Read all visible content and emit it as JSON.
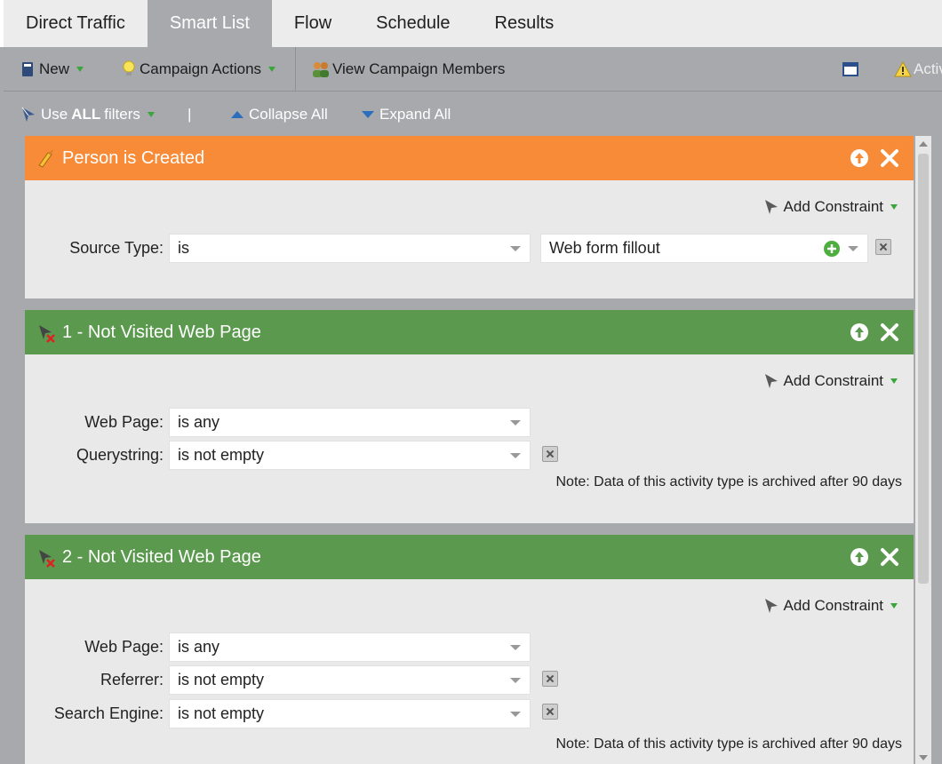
{
  "tabs": [
    "Direct Traffic",
    "Smart List",
    "Flow",
    "Schedule",
    "Results"
  ],
  "toolbar": {
    "new_label": "New",
    "campaign_actions_label": "Campaign Actions",
    "view_members_label": "View Campaign Members",
    "activate_label": "Activ"
  },
  "filterbar": {
    "use_label": "Use",
    "all_label": "ALL",
    "filters_label": "filters",
    "separator": "|",
    "collapse_label": "Collapse All",
    "expand_label": "Expand All"
  },
  "filters": [
    {
      "title": "Person is Created",
      "color": "#f78b37",
      "add_constraint": "Add Constraint",
      "rows": [
        {
          "label": "Source Type:",
          "operator": "is",
          "value": "Web form fillout"
        }
      ]
    },
    {
      "title": "1 - Not Visited Web Page",
      "color": "#5b9a4e",
      "add_constraint": "Add Constraint",
      "rows": [
        {
          "label": "Web Page:",
          "operator": "is any"
        },
        {
          "label": "Querystring:",
          "operator": "is not empty"
        }
      ],
      "note": "Note: Data of this activity type is archived after 90 days"
    },
    {
      "title": "2 - Not Visited Web Page",
      "color": "#5b9a4e",
      "add_constraint": "Add Constraint",
      "rows": [
        {
          "label": "Web Page:",
          "operator": "is any"
        },
        {
          "label": "Referrer:",
          "operator": "is not empty"
        },
        {
          "label": "Search Engine:",
          "operator": "is not empty"
        }
      ],
      "note": "Note: Data of this activity type is archived after 90 days"
    }
  ]
}
